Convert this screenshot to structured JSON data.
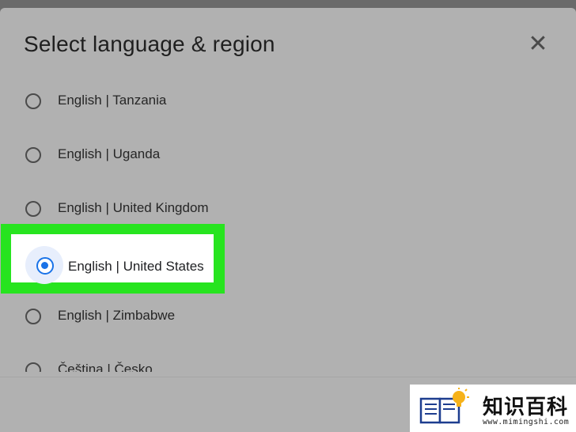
{
  "dialog": {
    "title": "Select language & region",
    "close_glyph": "✕"
  },
  "options": [
    {
      "label": "English | Tanzania",
      "selected": false
    },
    {
      "label": "English | Uganda",
      "selected": false
    },
    {
      "label": "English | United Kingdom",
      "selected": false
    },
    {
      "label": "English | United States",
      "selected": true
    },
    {
      "label": "English | Zimbabwe",
      "selected": false
    },
    {
      "label": "Čeština | Česko",
      "selected": false
    }
  ],
  "colors": {
    "accent": "#1a73e8",
    "highlight": "#27e41f",
    "overlay": "#b1b1b1"
  },
  "watermark": {
    "title": "知识百科",
    "url": "www.mimingshi.com"
  }
}
